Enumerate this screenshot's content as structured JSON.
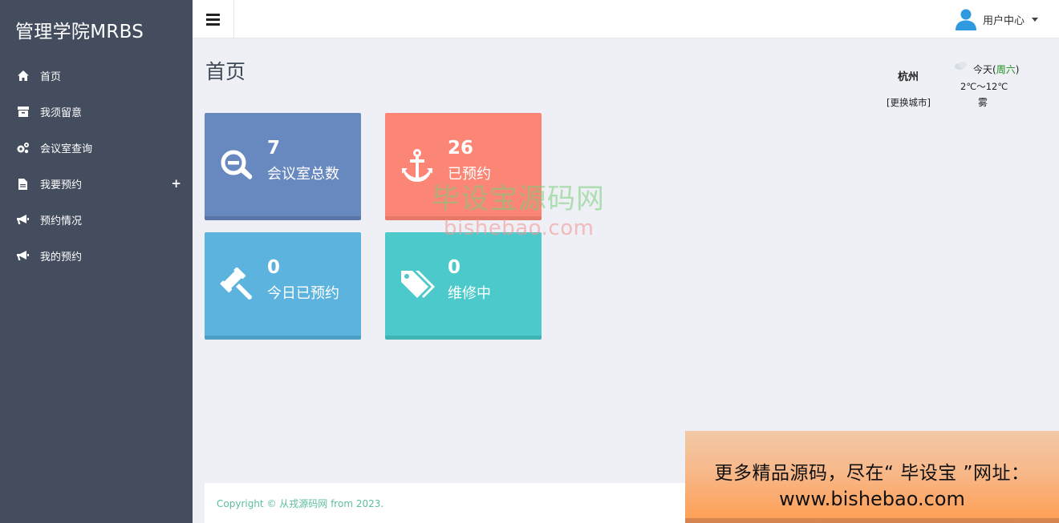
{
  "sidebar": {
    "brand": "管理学院MRBS",
    "items": [
      {
        "label": "首页",
        "icon": "home-icon"
      },
      {
        "label": "我须留意",
        "icon": "archive-icon"
      },
      {
        "label": "会议室查询",
        "icon": "cogs-icon"
      },
      {
        "label": "我要预约",
        "icon": "file-icon",
        "expand": "+"
      },
      {
        "label": "预约情况",
        "icon": "bullhorn-icon"
      },
      {
        "label": "我的预约",
        "icon": "bullhorn-icon"
      }
    ]
  },
  "topbar": {
    "user_menu": "用户中心"
  },
  "main": {
    "title": "首页"
  },
  "weather": {
    "city": "杭州",
    "change_city": "[更换城市]",
    "today_prefix": "今天(",
    "day_of_week": "周六",
    "today_suffix": ")",
    "temperature": "2℃～12℃",
    "condition": "雾"
  },
  "cards": [
    {
      "value": "7",
      "label": "会议室总数",
      "icon": "search-minus-icon",
      "color": "#6889c0"
    },
    {
      "value": "26",
      "label": "已预约",
      "icon": "anchor-icon",
      "color": "#fc8675"
    },
    {
      "value": "0",
      "label": "今日已预约",
      "icon": "gavel-icon",
      "color": "#5cb4de"
    },
    {
      "value": "0",
      "label": "维修中",
      "icon": "tags-icon",
      "color": "#4cc9cb"
    }
  ],
  "watermark": {
    "line1": "毕设宝源码网",
    "line2": "bishebao.com"
  },
  "footer": {
    "copyright": "Copyright © 从戎源码网 from 2023."
  },
  "promo": {
    "line1": "更多精品源码，尽在“ 毕设宝 ”网址：",
    "line2": "www.bishebao.com"
  }
}
